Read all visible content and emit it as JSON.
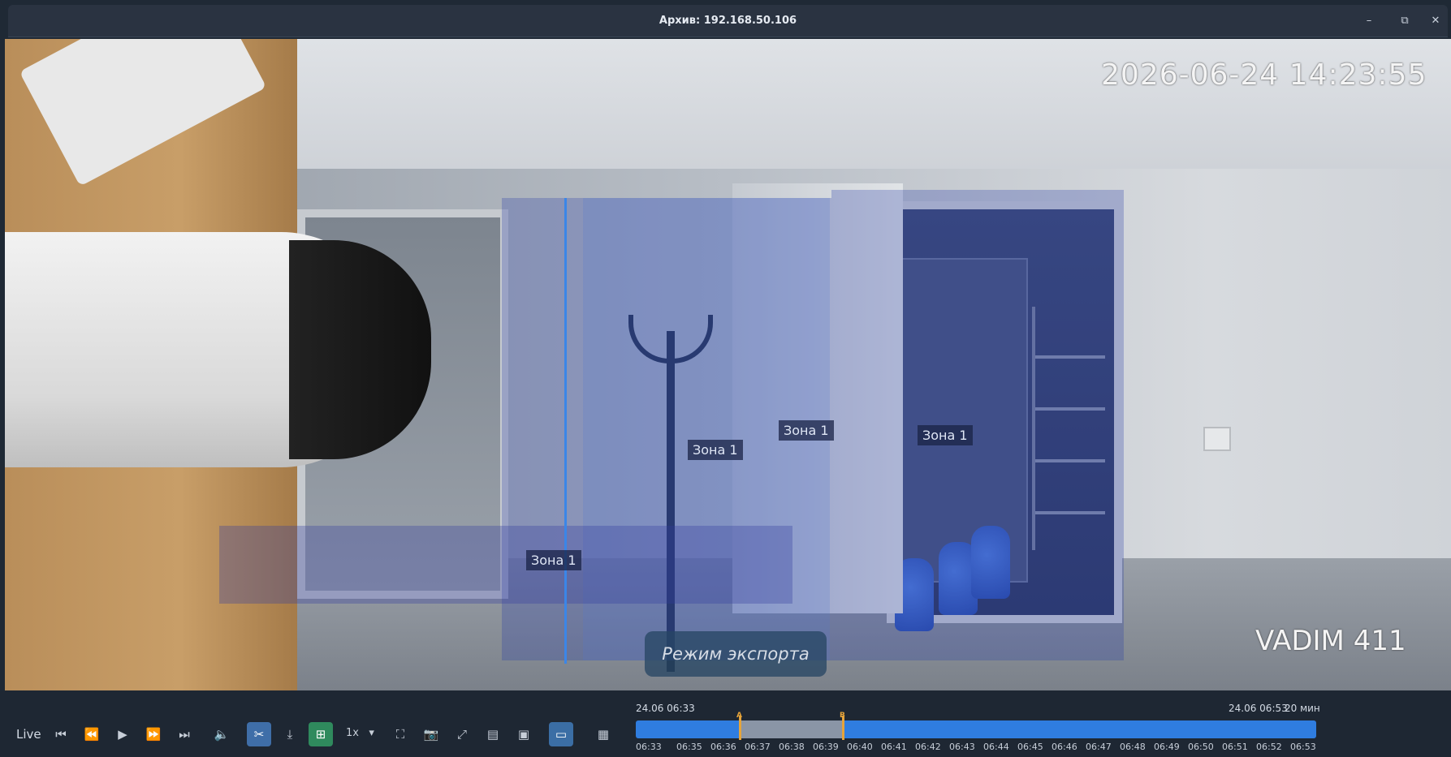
{
  "window": {
    "title": "Архив: 192.168.50.106",
    "minimize_icon": "minimize-icon",
    "maximize_icon": "maximize-icon",
    "close_icon": "close-icon"
  },
  "video": {
    "timestamp": "2026-06-24 14:23:55",
    "camera_name": "VADIM 411",
    "export_mode": "Режим экспорта",
    "zones": [
      "Зона 1",
      "Зона 1",
      "Зона 1",
      "Зона 1"
    ]
  },
  "controls": {
    "live_label": "Live",
    "speed_label": "1x"
  },
  "timeline": {
    "start_label": "24.06 06:33",
    "end_label": "24.06 06:53",
    "duration_label": "20 мин",
    "marker_a": "A",
    "marker_b": "B",
    "ticks": [
      "06:33",
      "06:35",
      "06:36",
      "06:37",
      "06:38",
      "06:39",
      "06:40",
      "06:41",
      "06:42",
      "06:43",
      "06:44",
      "06:45",
      "06:46",
      "06:47",
      "06:48",
      "06:49",
      "06:50",
      "06:51",
      "06:52",
      "06:53"
    ]
  },
  "colors": {
    "timeline_fill": "#2f7de0",
    "marker": "#e6a43a",
    "zone": "#283caa"
  }
}
